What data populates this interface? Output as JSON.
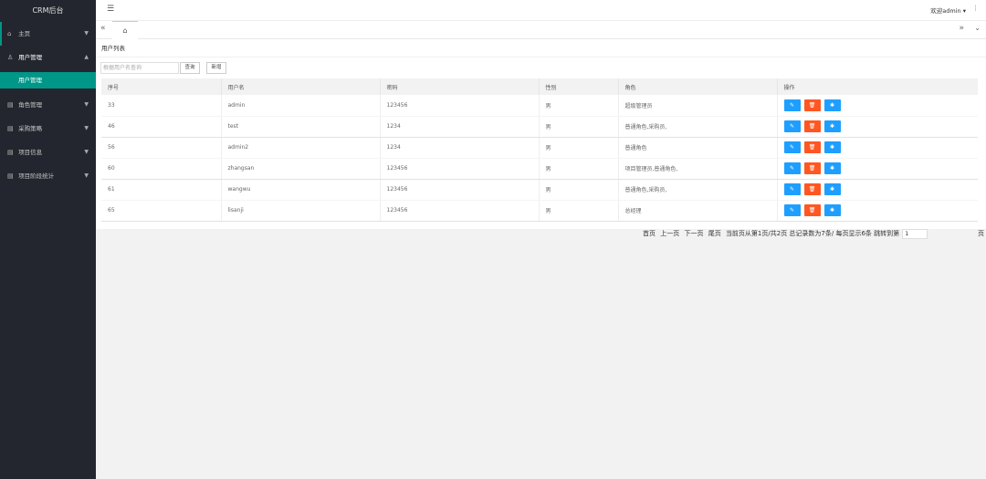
{
  "sidebar": {
    "logo": "CRM后台",
    "items": [
      {
        "label": "主页",
        "icon": "home-icon",
        "glyph": "⌂"
      },
      {
        "label": "用户管理",
        "icon": "user-icon",
        "glyph": "♙"
      },
      {
        "label": "角色管理",
        "icon": "list-icon",
        "glyph": "▤"
      },
      {
        "label": "采购策略",
        "icon": "list-icon",
        "glyph": "▤"
      },
      {
        "label": "项目信息",
        "icon": "list-icon",
        "glyph": "▤"
      },
      {
        "label": "项目阶段统计",
        "icon": "list-icon",
        "glyph": "▤"
      }
    ],
    "sub_item": "用户管理"
  },
  "header": {
    "menu_icon": "☰",
    "welcome": "欢迎admin ▾",
    "more": "⋮"
  },
  "tabs": {
    "prev": "«",
    "home": "⌂",
    "next": "»",
    "down": "⌄"
  },
  "panel": {
    "title": "用户列表",
    "search_placeholder": "根据用户名查询",
    "query_label": "查询",
    "add_label": "新增"
  },
  "table": {
    "headers": [
      "序号",
      "用户名",
      "密码",
      "性别",
      "角色",
      "操作"
    ],
    "rows": [
      {
        "id": "33",
        "username": "admin",
        "password": "123456",
        "gender": "男",
        "roles": "超级管理员"
      },
      {
        "id": "46",
        "username": "test",
        "password": "1234",
        "gender": "男",
        "roles": "普通角色,采购员,"
      },
      {
        "id": "56",
        "username": "admin2",
        "password": "1234",
        "gender": "男",
        "roles": "普通角色"
      },
      {
        "id": "60",
        "username": "zhangsan",
        "password": "123456",
        "gender": "男",
        "roles": "项目管理员,普通角色,"
      },
      {
        "id": "61",
        "username": "wangwu",
        "password": "123456",
        "gender": "男",
        "roles": "普通角色,采购员,"
      },
      {
        "id": "65",
        "username": "lisanji",
        "password": "123456",
        "gender": "男",
        "roles": "总经理"
      }
    ],
    "actions": {
      "edit": "✎",
      "delete": "🗑",
      "settings": "✱"
    }
  },
  "pagination": {
    "first": "首页",
    "prev": "上一页",
    "next": "下一页",
    "last": "尾页",
    "info": "当前页从第1页/共2页 总记录数为7条/ 每页显示6条 跳转到第",
    "jump_value": "1",
    "page_suffix": "页"
  }
}
